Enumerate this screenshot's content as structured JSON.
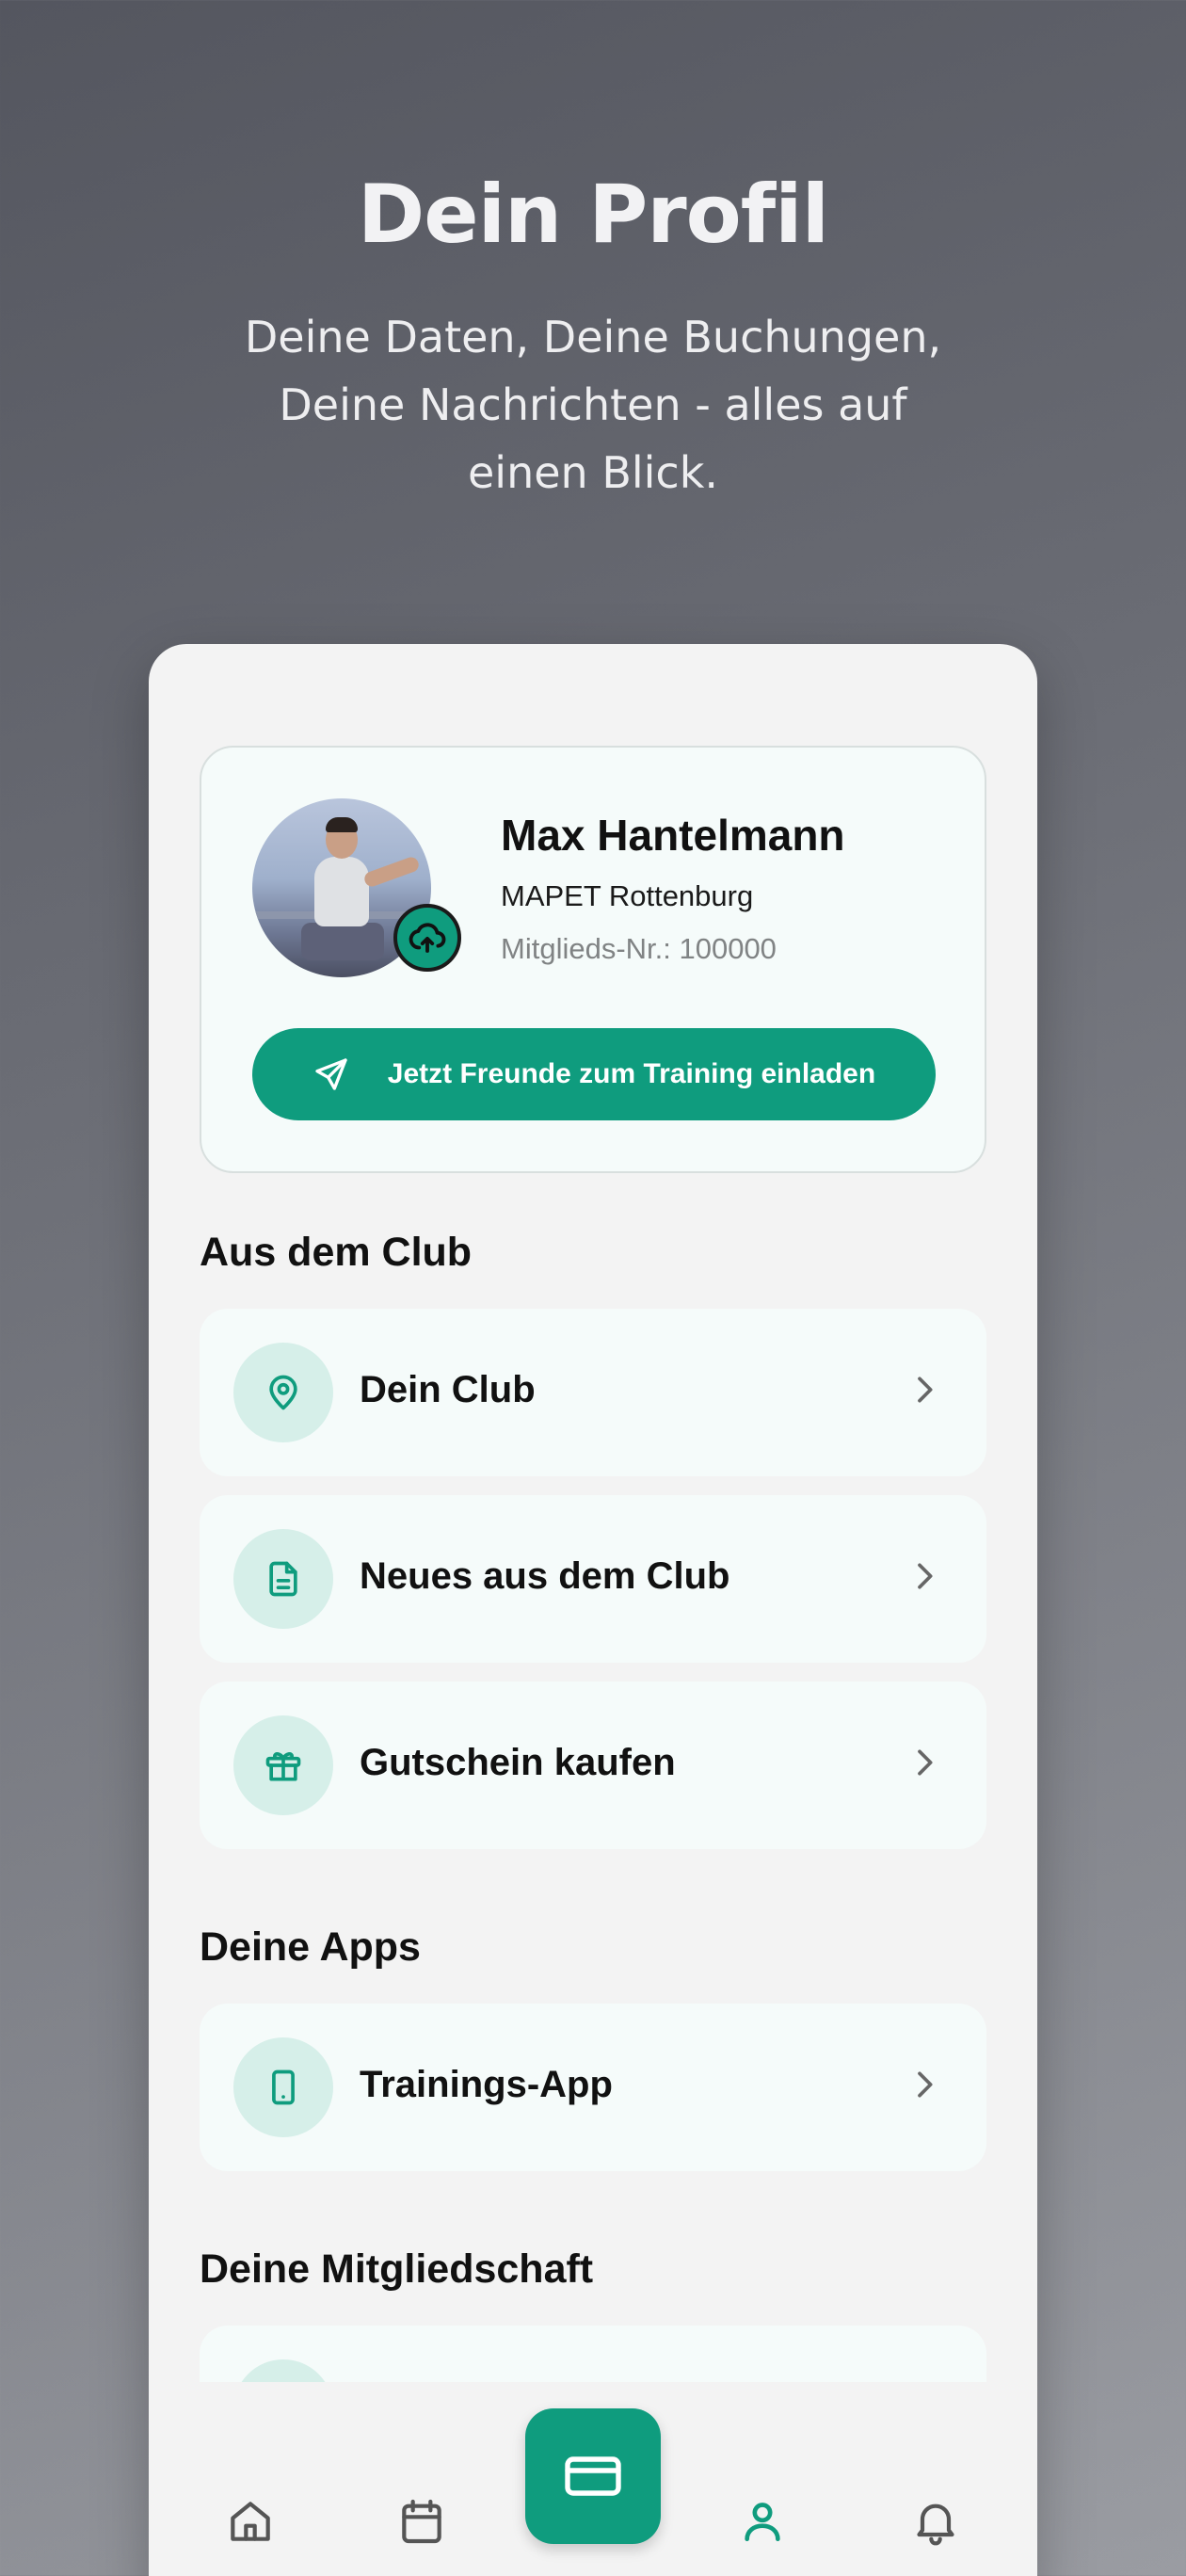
{
  "hero": {
    "title": "Dein Profil",
    "subtitle_line1": "Deine Daten, Deine Buchungen,",
    "subtitle_line2": "Deine Nachrichten - alles auf",
    "subtitle_line3": "einen Blick."
  },
  "profile": {
    "name": "Max Hantelmann",
    "club": "MAPET Rottenburg",
    "member_number": "Mitglieds-Nr.: 100000",
    "invite_label": "Jetzt Freunde zum Training einladen"
  },
  "sections": {
    "club_title": "Aus dem Club",
    "apps_title": "Deine Apps",
    "membership_title": "Deine Mitgliedschaft"
  },
  "club_items": [
    {
      "label": "Dein Club",
      "icon": "location-pin-icon"
    },
    {
      "label": "Neues aus dem Club",
      "icon": "document-icon"
    },
    {
      "label": "Gutschein kaufen",
      "icon": "gift-icon"
    }
  ],
  "app_items": [
    {
      "label": "Trainings-App",
      "icon": "smartphone-icon"
    }
  ],
  "nav": {
    "items": [
      "home-icon",
      "calendar-icon",
      "card-icon",
      "profile-icon",
      "bell-icon"
    ],
    "active": "profile-icon"
  },
  "colors": {
    "accent": "#0f9c7e",
    "icon_bg": "#d6efe9",
    "card_bg": "#f5fbfa",
    "screen_bg": "#f3f3f3"
  }
}
